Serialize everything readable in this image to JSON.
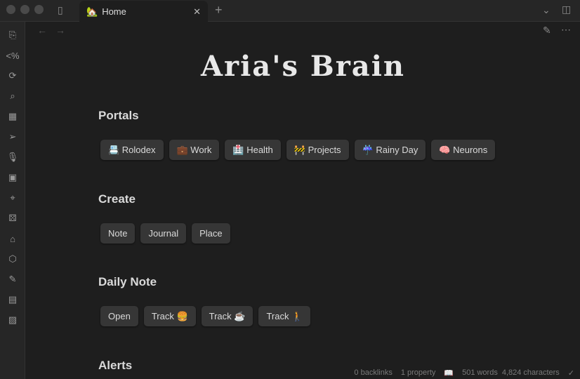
{
  "tab": {
    "icon": "🏡",
    "label": "Home"
  },
  "title": "Aria's Brain",
  "sections": [
    {
      "heading": "Portals",
      "buttons": [
        "📇 Rolodex",
        "💼 Work",
        "🏥 Health",
        "🚧 Projects",
        "☔ Rainy Day",
        "🧠 Neurons"
      ]
    },
    {
      "heading": "Create",
      "buttons": [
        "Note",
        "Journal",
        "Place"
      ]
    },
    {
      "heading": "Daily Note",
      "buttons": [
        "Open",
        "Track 🍔",
        "Track ☕",
        "Track 🚶"
      ]
    },
    {
      "heading": "Alerts",
      "buttons": []
    }
  ],
  "status": {
    "backlinks": "0 backlinks",
    "properties": "1 property",
    "words": "501 words",
    "chars": "4,824 characters"
  }
}
